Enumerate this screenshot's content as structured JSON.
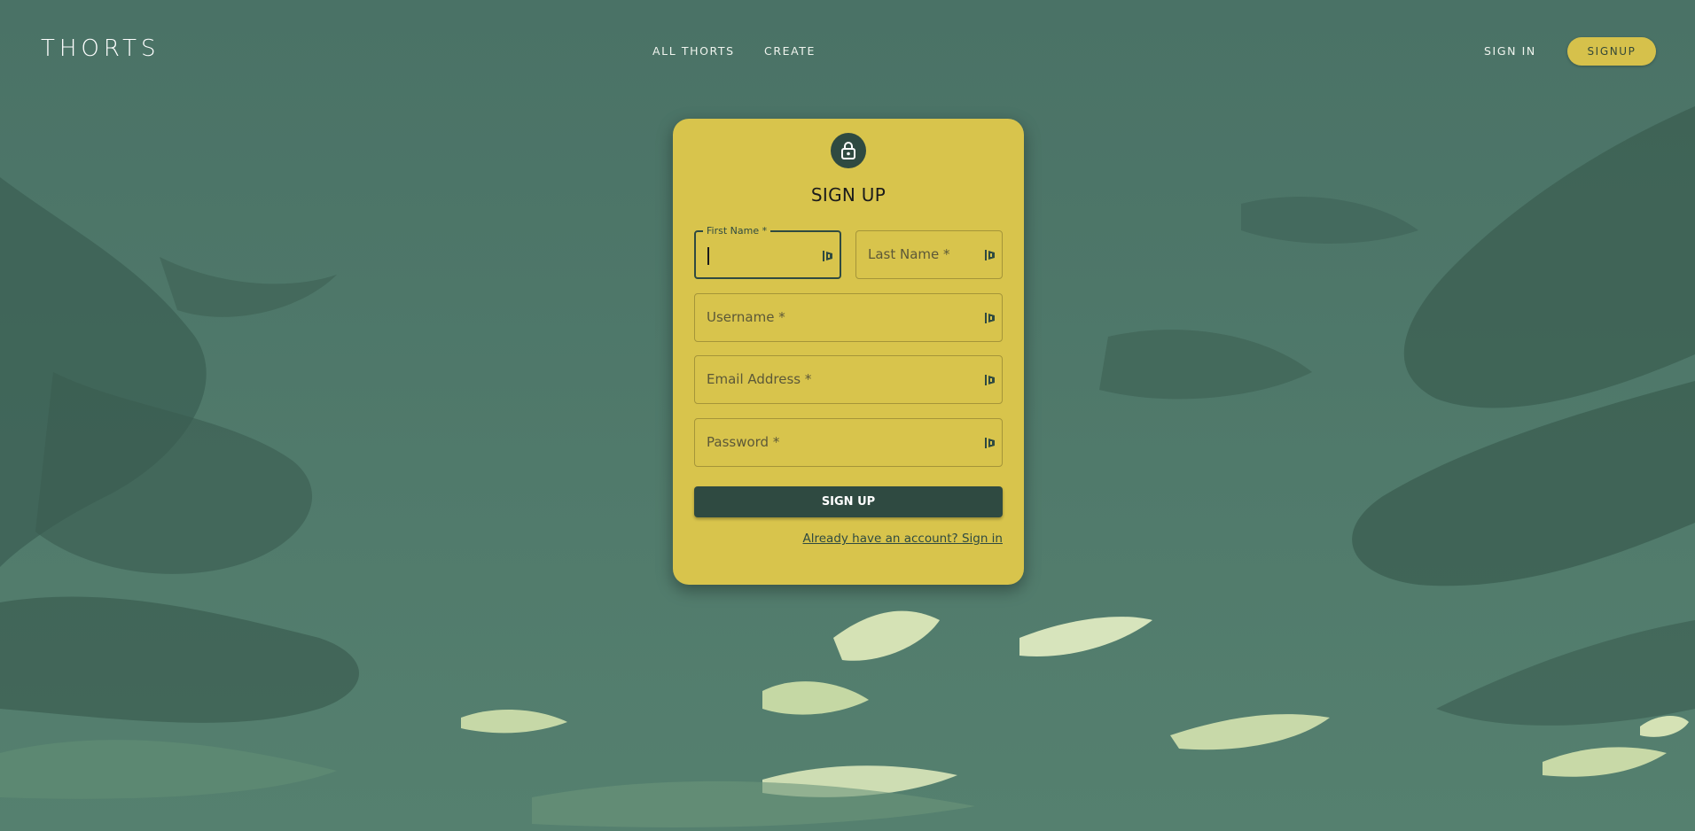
{
  "nav": {
    "logo": "THORTS",
    "links": [
      {
        "label": "ALL THORTS"
      },
      {
        "label": "CREATE"
      }
    ],
    "sign_in": "SIGN IN",
    "signup": "SIGNUP"
  },
  "form": {
    "icon": "lock-icon",
    "title": "SIGN UP",
    "fields": {
      "first_name": {
        "label": "First Name *",
        "value": ""
      },
      "last_name": {
        "label": "Last Name *",
        "value": ""
      },
      "username": {
        "label": "Username *",
        "value": ""
      },
      "email": {
        "label": "Email Address *",
        "value": ""
      },
      "password": {
        "label": "Password *",
        "value": ""
      }
    },
    "submit": "SIGN UP",
    "signin_link": "Already have an account? Sign in"
  },
  "colors": {
    "card": "#d8c44c",
    "accent_dark": "#2f4a41",
    "pill": "#d6c14b"
  }
}
